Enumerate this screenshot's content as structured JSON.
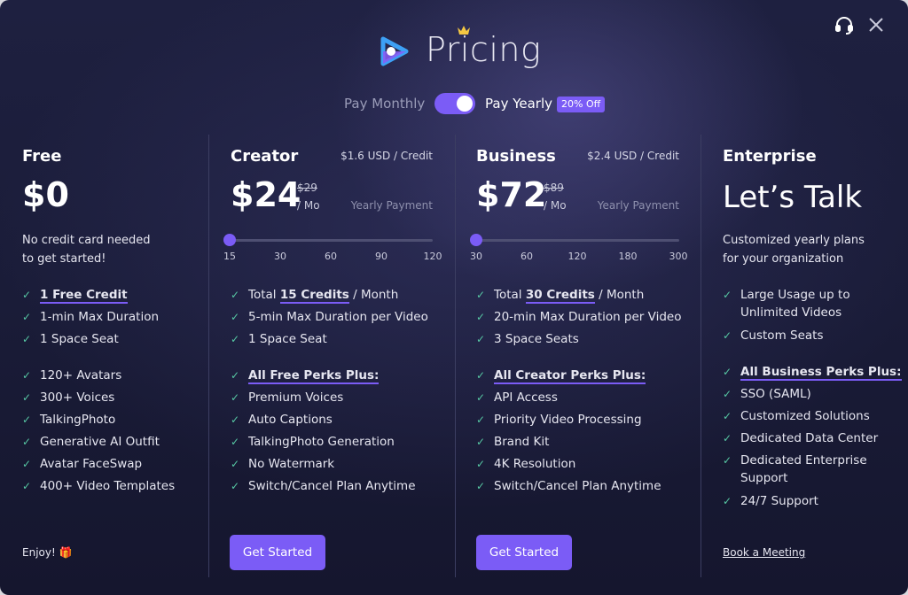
{
  "header": {
    "title": "Pricing",
    "billing_options": {
      "monthly": "Pay Monthly",
      "yearly": "Pay Yearly",
      "discount": "20% Off",
      "yearly_selected": true
    }
  },
  "colors": {
    "accent": "#7b5cf6",
    "check": "#57c8a4",
    "gift": "#f5a623"
  },
  "icons": {
    "support": "headset-icon",
    "close": "close-icon",
    "logo": "play-logo-icon",
    "crown": "crown-icon",
    "check": "check-icon",
    "gift": "gift-icon"
  },
  "plans": [
    {
      "name": "Free",
      "price": "$0",
      "description": [
        "No credit card needed",
        "to get started!"
      ],
      "features_a": [
        "1 Free Credit",
        "1-min Max Duration",
        "1 Space Seat"
      ],
      "features_b": [
        "120+ Avatars",
        "300+ Voices",
        "TalkingPhoto",
        "Generative AI Outfit",
        "Avatar FaceSwap",
        "400+ Video Templates"
      ],
      "footer": "Enjoy!"
    },
    {
      "name": "Creator",
      "credit_rate": "$1.6 USD / Credit",
      "price": "$24",
      "old_price": "$29",
      "per": "/ Mo",
      "payment_note": "Yearly Payment",
      "slider": {
        "ticks": [
          "15",
          "30",
          "60",
          "90",
          "120"
        ],
        "value": "15"
      },
      "features_a": {
        "credits_prefix": "Total ",
        "credits": "15 Credits",
        "credits_suffix": " / Month",
        "items": [
          "5-min Max Duration per Video",
          "1 Space Seat"
        ]
      },
      "perks_title": "All Free Perks Plus:",
      "features_b": [
        "Premium Voices",
        "Auto Captions",
        "TalkingPhoto Generation",
        "No Watermark",
        "Switch/Cancel Plan Anytime"
      ],
      "cta": "Get Started"
    },
    {
      "name": "Business",
      "credit_rate": "$2.4 USD / Credit",
      "price": "$72",
      "old_price": "$89",
      "per": "/ Mo",
      "payment_note": "Yearly Payment",
      "slider": {
        "ticks": [
          "30",
          "60",
          "120",
          "180",
          "300"
        ],
        "value": "30"
      },
      "features_a": {
        "credits_prefix": "Total ",
        "credits": "30 Credits",
        "credits_suffix": " / Month",
        "items": [
          "20-min Max Duration per Video",
          "3 Space Seats"
        ]
      },
      "perks_title": "All Creator Perks Plus:",
      "features_b": [
        "API Access",
        "Priority Video Processing",
        "Brand Kit",
        "4K Resolution",
        "Switch/Cancel Plan Anytime"
      ],
      "cta": "Get Started"
    },
    {
      "name": "Enterprise",
      "price": "Let’s Talk",
      "description": [
        "Customized yearly plans",
        "for your organization"
      ],
      "features_a": [
        [
          "Large Usage up to",
          "Unlimited Videos"
        ],
        [
          "Custom Seats"
        ]
      ],
      "perks_title": "All Business Perks Plus:",
      "features_b": [
        [
          "SSO (SAML)"
        ],
        [
          "Customized Solutions"
        ],
        [
          "Dedicated Data Center"
        ],
        [
          "Dedicated Enterprise",
          "Support"
        ],
        [
          "24/7 Support"
        ]
      ],
      "footer_link": "Book a Meeting"
    }
  ]
}
